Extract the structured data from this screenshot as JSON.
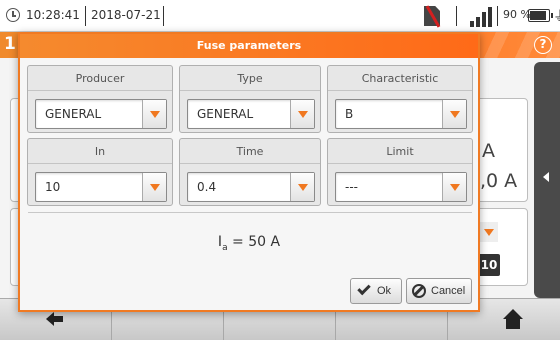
{
  "statusbar": {
    "time": "10:28:41",
    "date": "2018-07-21",
    "battery_percent": "90 %",
    "icons": [
      "clock-icon",
      "sd-card-missing-icon",
      "signal-icon",
      "battery-icon",
      "plug-icon"
    ]
  },
  "header": {
    "number": "1",
    "help_icon": "?"
  },
  "background": {
    "value_a": "A",
    "value_b": ",0 A",
    "badge": "10"
  },
  "dialog": {
    "title": "Fuse parameters",
    "fields": [
      {
        "label": "Producer",
        "value": "GENERAL"
      },
      {
        "label": "Type",
        "value": "GENERAL"
      },
      {
        "label": "Characteristic",
        "value": "B"
      },
      {
        "label": "In",
        "value": "10"
      },
      {
        "label": "Time",
        "value": "0.4"
      },
      {
        "label": "Limit",
        "value": "---"
      }
    ],
    "result": {
      "symbol": "I",
      "subscript": "a",
      "text": " = 50 A"
    },
    "buttons": {
      "ok": "Ok",
      "cancel": "Cancel"
    }
  },
  "colors": {
    "accent": "#f07820",
    "header": "#ff6f1a"
  }
}
